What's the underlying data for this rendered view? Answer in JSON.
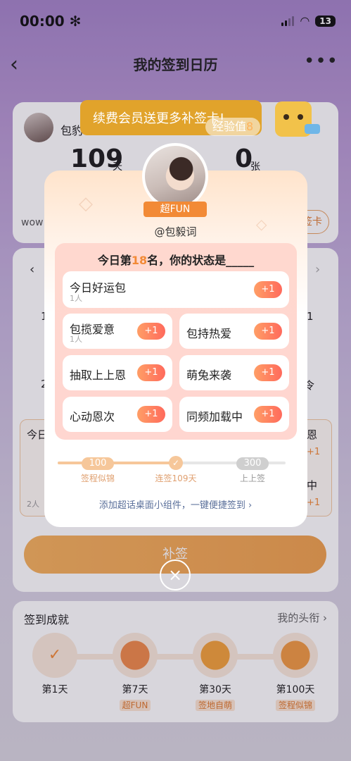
{
  "status": {
    "time": "00:00",
    "battery": "13"
  },
  "nav": {
    "title": "我的签到日历",
    "back": "‹",
    "more": "•••"
  },
  "background": {
    "user_name_partial": "包豹",
    "days_count": "109",
    "days_unit": "天",
    "cards_count": "0",
    "cards_unit": "张",
    "row_text_left": "wow",
    "row_button_right": "签卡",
    "cal_left_nums": [
      "1",
      "2"
    ],
    "cal_right_nums": [
      "1",
      "令"
    ],
    "today_box_label": "今日",
    "today_box_people": "2人",
    "right_labels": [
      "恩",
      "中"
    ],
    "right_plus": [
      "+1",
      "+1"
    ],
    "big_button": "补签"
  },
  "promo": {
    "text": "续费会员送更多补签卡!",
    "exp_label": "经验值",
    "exp_value": "8"
  },
  "modal": {
    "badge": "超FUN",
    "handle": "@包毅词",
    "question_prefix": "今日第",
    "rank": "18",
    "question_suffix": "名，你的状态是_____",
    "options": [
      {
        "label": "今日好运包",
        "count": "1人",
        "plus": "+1"
      },
      {
        "label": "包揽爱意",
        "count": "1人",
        "plus": "+1"
      },
      {
        "label": "包持热爱",
        "count": "",
        "plus": "+1"
      },
      {
        "label": "抽取上上恩",
        "count": "",
        "plus": "+1"
      },
      {
        "label": "萌兔来袭",
        "count": "",
        "plus": "+1"
      },
      {
        "label": "心动恩次",
        "count": "",
        "plus": "+1"
      },
      {
        "label": "同频加载中",
        "count": "",
        "plus": "+1"
      }
    ],
    "progress": {
      "ms1": {
        "pill": "100天",
        "caption": "签程似锦"
      },
      "ms2": {
        "caption": "连签109天"
      },
      "ms3": {
        "pill": "300天",
        "caption": "上上签"
      }
    },
    "add_widget": "添加超话桌面小组件，一键便捷签到 ›",
    "close": "×"
  },
  "achievements": {
    "title": "签到成就",
    "link": "我的头衔 ›",
    "items": [
      {
        "day": "第1天",
        "tag": ""
      },
      {
        "day": "第7天",
        "tag": "超FUN"
      },
      {
        "day": "第30天",
        "tag": "签地自萌"
      },
      {
        "day": "第100天",
        "tag": "签程似锦"
      }
    ]
  },
  "colors": {
    "accent": "#f28a36",
    "promo": "#e1a32b",
    "plus_gradient_start": "#ff9e66",
    "plus_gradient_end": "#ff6a5c"
  },
  "icons": [
    "back-icon",
    "more-icon",
    "snowflake-icon",
    "signal-icon",
    "wifi-icon",
    "battery-icon",
    "diamond-icon",
    "check-icon",
    "close-icon",
    "chevron-right-icon"
  ]
}
